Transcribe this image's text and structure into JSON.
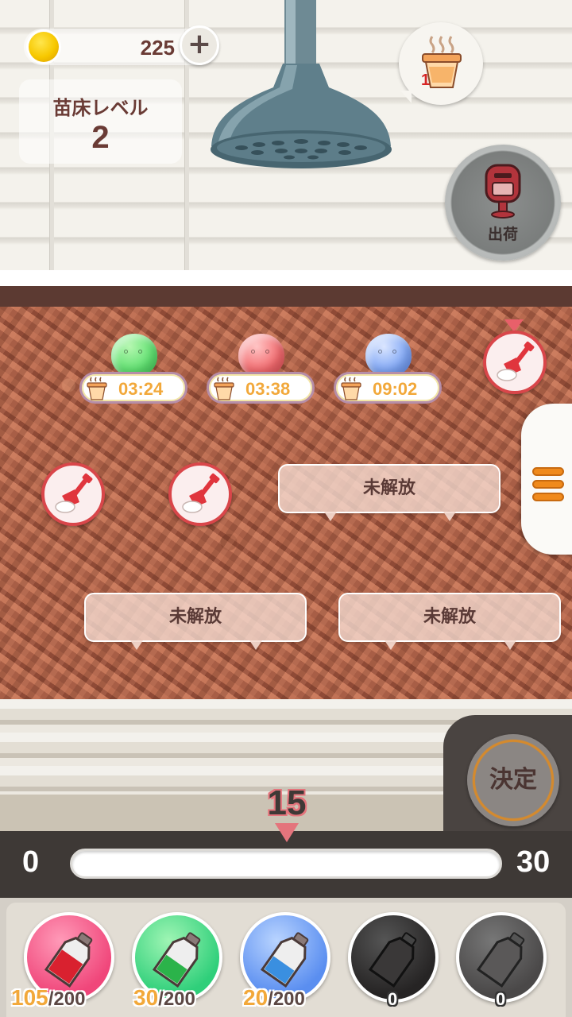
{
  "header": {
    "coins": "225",
    "coin_add_label": "+",
    "bed_level_label": "苗床レベル",
    "bed_level_value": "2",
    "order_count": "1",
    "ship_label": "出荷"
  },
  "field": {
    "slimes": [
      {
        "color": "#5fe070",
        "timer": "03:24"
      },
      {
        "color": "#f26a6e",
        "timer": "03:38"
      },
      {
        "color": "#7fa6f5",
        "timer": "09:02"
      }
    ],
    "locked_label": "未解放",
    "locked_plots": [
      "未解放",
      "未解放",
      "未解放"
    ]
  },
  "controls": {
    "decide_label": "決定",
    "slider_min": "0",
    "slider_max": "30",
    "slider_value": "15",
    "slider_fraction": 0.5
  },
  "potions": [
    {
      "color": "pink",
      "current": "105",
      "max": "/200"
    },
    {
      "color": "green",
      "current": "30",
      "max": "/200"
    },
    {
      "color": "blue",
      "current": "20",
      "max": "/200"
    },
    {
      "color": "black",
      "current": "0",
      "max": ""
    },
    {
      "color": "grey",
      "current": "0",
      "max": ""
    }
  ]
}
